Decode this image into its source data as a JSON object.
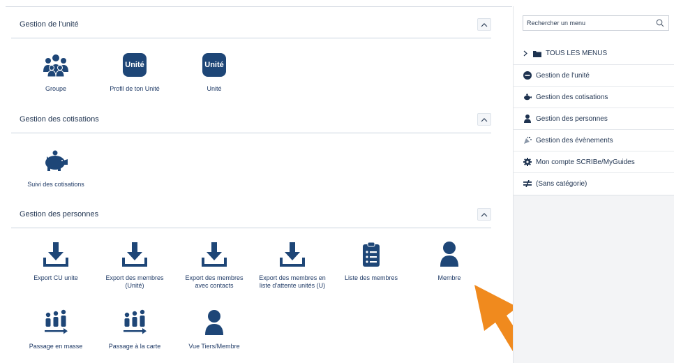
{
  "sections": [
    {
      "title": "Gestion de l'unité",
      "tiles": [
        {
          "label": "Groupe",
          "icon": "group-icon"
        },
        {
          "label": "Profil de ton Unité",
          "icon": "unite-badge-icon",
          "badge": "Unité"
        },
        {
          "label": "Unité",
          "icon": "unite-badge-icon",
          "badge": "Unité"
        }
      ]
    },
    {
      "title": "Gestion des cotisations",
      "tiles": [
        {
          "label": "Suivi des cotisations",
          "icon": "piggy-bank-icon"
        }
      ]
    },
    {
      "title": "Gestion des personnes",
      "tiles": [
        {
          "label": "Export CU unite",
          "icon": "download-icon"
        },
        {
          "label": "Export des membres\n(Unité)",
          "icon": "download-icon"
        },
        {
          "label": "Export des membres\navec contacts",
          "icon": "download-icon"
        },
        {
          "label": "Export des membres en\nliste d'attente unités (U)",
          "icon": "download-icon"
        },
        {
          "label": "Liste des membres",
          "icon": "clipboard-list-icon"
        },
        {
          "label": "Membre",
          "icon": "person-icon"
        },
        {
          "label": "Passage en masse",
          "icon": "people-transfer-icon"
        },
        {
          "label": "Passage à la carte",
          "icon": "people-transfer-icon"
        },
        {
          "label": "Vue Tiers/Membre",
          "icon": "person-icon"
        }
      ]
    }
  ],
  "sidebar": {
    "search_placeholder": "Rechercher un menu",
    "items": [
      {
        "label": "TOUS LES MENUS",
        "icon": "folder-icon"
      },
      {
        "label": "Gestion de l'unité",
        "icon": "scribe-icon"
      },
      {
        "label": "Gestion des cotisations",
        "icon": "piggy-bank-icon"
      },
      {
        "label": "Gestion des personnes",
        "icon": "person-icon"
      },
      {
        "label": "Gestion des évènements",
        "icon": "party-icon"
      },
      {
        "label": "Mon compte SCRIBe/MyGuides",
        "icon": "gear-icon"
      },
      {
        "label": "(Sans catégorie)",
        "icon": "not-equal-icon"
      }
    ]
  },
  "colors": {
    "icon_blue": "#1e4677",
    "text_navy": "#1f3350",
    "arrow_orange": "#f08a1e"
  }
}
